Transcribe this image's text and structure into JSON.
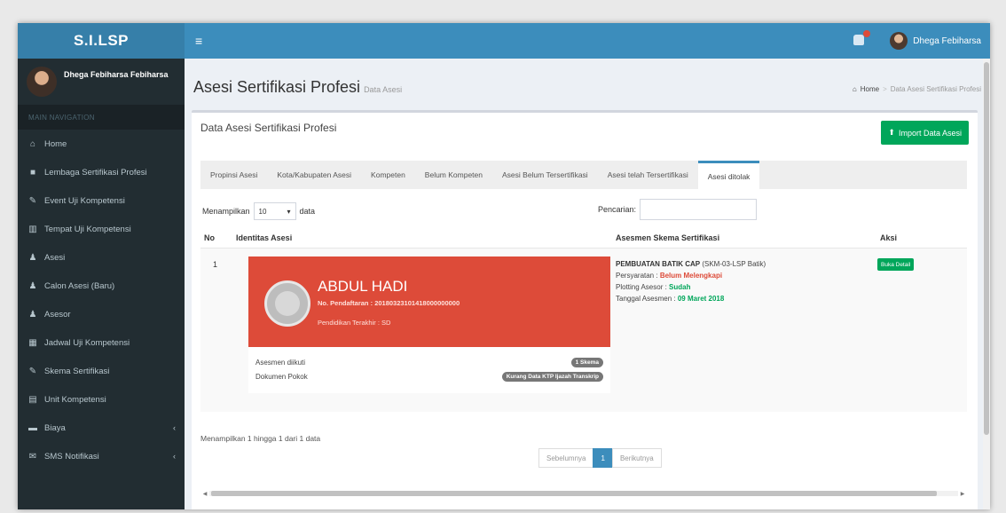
{
  "app": {
    "logo": "S.I.LSP"
  },
  "topbar": {
    "menu_icon": "≡",
    "user_name": "Dhega Febiharsa"
  },
  "sidebar": {
    "user_name": "Dhega Febiharsa Febiharsa",
    "header": "MAIN NAVIGATION",
    "items": [
      {
        "label": "Home",
        "icon": "home-icon",
        "glyph": "⌂"
      },
      {
        "label": "Lembaga Sertifikasi Profesi",
        "icon": "book-icon",
        "glyph": "■"
      },
      {
        "label": "Event Uji Kompetensi",
        "icon": "edit-icon",
        "glyph": "✎"
      },
      {
        "label": "Tempat Uji Kompetensi",
        "icon": "bank-icon",
        "glyph": "▥"
      },
      {
        "label": "Asesi",
        "icon": "users-icon",
        "glyph": "♟"
      },
      {
        "label": "Calon Asesi (Baru)",
        "icon": "users-icon",
        "glyph": "♟"
      },
      {
        "label": "Asesor",
        "icon": "users-icon",
        "glyph": "♟"
      },
      {
        "label": "Jadwal Uji Kompetensi",
        "icon": "calendar-icon",
        "glyph": "▦"
      },
      {
        "label": "Skema Sertifikasi",
        "icon": "edit-icon",
        "glyph": "✎"
      },
      {
        "label": "Unit Kompetensi",
        "icon": "file-icon",
        "glyph": "▤"
      },
      {
        "label": "Biaya",
        "icon": "folder-icon",
        "glyph": "▬"
      },
      {
        "label": "SMS Notifikasi",
        "icon": "envelope-icon",
        "glyph": "✉"
      }
    ]
  },
  "page": {
    "title": "Asesi Sertifikasi Profesi",
    "subtitle": "Data Asesi",
    "breadcrumb": {
      "home": "Home",
      "current": "Data Asesi Sertifikasi Profesi"
    }
  },
  "box": {
    "title": "Data Asesi Sertifikasi Profesi",
    "import_label": "Import Data Asesi"
  },
  "tabs": [
    {
      "label": "Propinsi Asesi",
      "active": false
    },
    {
      "label": "Kota/Kabupaten Asesi",
      "active": false
    },
    {
      "label": "Kompeten",
      "active": false
    },
    {
      "label": "Belum Kompeten",
      "active": false
    },
    {
      "label": "Asesi Belum Tersertifikasi",
      "active": false
    },
    {
      "label": "Asesi telah Tersertifikasi",
      "active": false
    },
    {
      "label": "Asesi ditolak",
      "active": true
    }
  ],
  "table_controls": {
    "show_label": "Menampilkan",
    "show_value": "10",
    "show_suffix": "data",
    "search_label": "Pencarian:",
    "search_value": ""
  },
  "table": {
    "headers": {
      "no": "No",
      "identitas": "Identitas Asesi",
      "skema": "Asesmen Skema Sertifikasi",
      "aksi": "Aksi"
    },
    "row": {
      "no": "1",
      "name": "ABDUL HADI",
      "reg_label": "No. Pendaftaran :",
      "reg_value": "20180323101418000000000",
      "edu_label": "Pendidikan Terakhir :",
      "edu_value": "SD",
      "asesmen_label": "Asesmen diikuti",
      "asesmen_badge": "1 Skema",
      "dokumen_label": "Dokumen Pokok",
      "dokumen_badge": "Kurang Data KTP Ijazah Transkrip",
      "skema_name": "PEMBUATAN BATIK CAP",
      "skema_code": "(SKM-03-LSP Batik)",
      "persyaratan_label": "Persyaratan :",
      "persyaratan_value": "Belum Melengkapi",
      "plotting_label": "Plotting Asesor :",
      "plotting_value": "Sudah",
      "tanggal_label": "Tanggal Asesmen :",
      "tanggal_value": "09 Maret 2018",
      "action_label": "Buka Detail"
    }
  },
  "footer": {
    "info": "Menampilkan 1 hingga 1 dari 1 data",
    "prev": "Sebelumnya",
    "page": "1",
    "next": "Berikutnya"
  }
}
